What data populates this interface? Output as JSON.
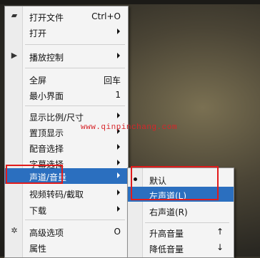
{
  "menu": {
    "items": [
      {
        "label": "打开文件",
        "shortcut": "Ctrl+O",
        "icon": "folder-icon"
      },
      {
        "label": "打开",
        "submenu": true
      },
      {
        "label": "播放控制",
        "submenu": true,
        "icon": "play-icon"
      },
      {
        "label": "全屏",
        "shortcut": "回车"
      },
      {
        "label": "最小界面",
        "shortcut": "1"
      },
      {
        "label": "显示比例/尺寸",
        "submenu": true
      },
      {
        "label": "置顶显示",
        "submenu": true
      },
      {
        "label": "配音选择",
        "submenu": true
      },
      {
        "label": "字幕选择",
        "submenu": true
      },
      {
        "label": "声道/音量",
        "submenu": true
      },
      {
        "label": "视频转码/截取",
        "submenu": true
      },
      {
        "label": "下载",
        "submenu": true
      },
      {
        "label": "高级选项",
        "shortcut": "O",
        "icon": "gear-icon"
      },
      {
        "label": "属性"
      }
    ]
  },
  "submenu": {
    "items": [
      {
        "label": "默认",
        "selected": true
      },
      {
        "label": "左声道(L)"
      },
      {
        "label": "右声道(R)"
      },
      {
        "label": "升高音量",
        "shortcut": "↑"
      },
      {
        "label": "降低音量",
        "shortcut": "↓"
      }
    ]
  },
  "watermark": "www.qinpinchang.com",
  "colors": {
    "highlight": "#2b6fbf",
    "annotation": "#e11b1b",
    "watermark": "#d7252a"
  }
}
